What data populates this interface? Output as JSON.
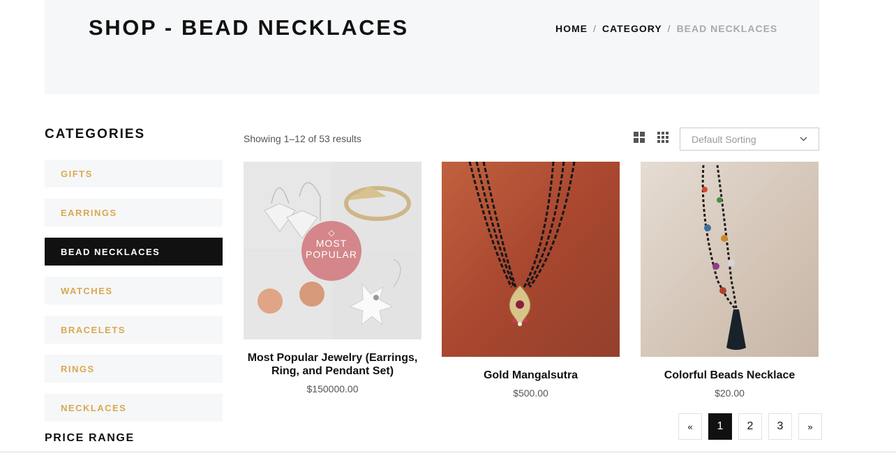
{
  "header": {
    "title": "SHOP - BEAD NECKLACES",
    "breadcrumb": {
      "home": "HOME",
      "category": "CATEGORY",
      "current": "BEAD NECKLACES",
      "separator": "/"
    }
  },
  "sidebar": {
    "title": "CATEGORIES",
    "items": [
      {
        "label": "GIFTS",
        "active": false
      },
      {
        "label": "EARRINGS",
        "active": false
      },
      {
        "label": "BEAD NECKLACES",
        "active": true
      },
      {
        "label": "WATCHES",
        "active": false
      },
      {
        "label": "BRACELETS",
        "active": false
      },
      {
        "label": "RINGS",
        "active": false
      },
      {
        "label": "NECKLACES",
        "active": false
      }
    ],
    "price_range_title": "PRICE RANGE"
  },
  "toolbar": {
    "results_text": "Showing 1–12 of 53 results",
    "sort_label": "Default Sorting",
    "view_icons": [
      "grid-2-icon",
      "grid-3-icon"
    ]
  },
  "products": [
    {
      "name": "Most Popular Jewelry (Earrings, Ring, and Pendant Set)",
      "price": "$150000.00",
      "badge_line1": "MOST",
      "badge_line2": "POPULAR"
    },
    {
      "name": "Gold Mangalsutra",
      "price": "$500.00"
    },
    {
      "name": "Colorful Beads Necklace",
      "price": "$20.00"
    }
  ],
  "pagination": {
    "prev": "«",
    "pages": [
      "1",
      "2",
      "3"
    ],
    "current": "1",
    "next": "»"
  },
  "colors": {
    "accent": "#d9a84f",
    "active_bg": "#111111",
    "panel_bg": "#f6f7f8",
    "badge": "#d4868a"
  }
}
